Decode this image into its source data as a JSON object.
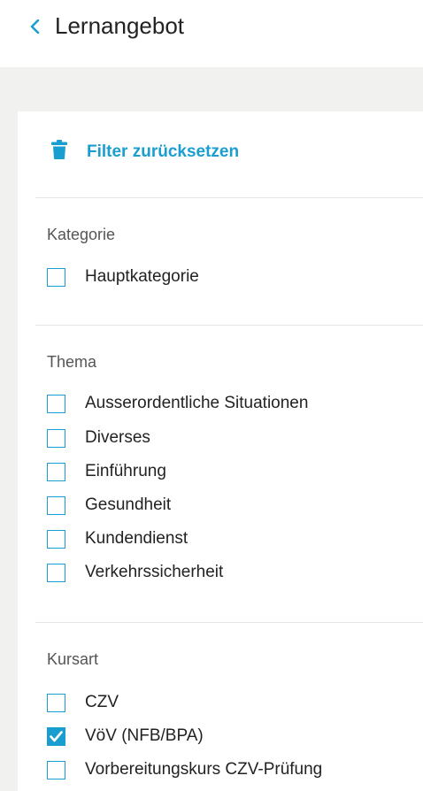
{
  "header": {
    "title": "Lernangebot",
    "back_icon": "chevron-left-icon",
    "accent_color": "#1a9ecf"
  },
  "filters": {
    "reset_label": "Filter zurücksetzen",
    "reset_icon": "trash-icon",
    "sections": [
      {
        "title": "Kategorie",
        "options": [
          {
            "label": "Hauptkategorie",
            "checked": false
          }
        ]
      },
      {
        "title": "Thema",
        "options": [
          {
            "label": "Ausserordentliche Situationen",
            "checked": false
          },
          {
            "label": "Diverses",
            "checked": false
          },
          {
            "label": "Einführung",
            "checked": false
          },
          {
            "label": "Gesundheit",
            "checked": false
          },
          {
            "label": "Kundendienst",
            "checked": false
          },
          {
            "label": "Verkehrssicherheit",
            "checked": false
          }
        ]
      },
      {
        "title": "Kursart",
        "options": [
          {
            "label": "CZV",
            "checked": false
          },
          {
            "label": "VöV (NFB/BPA)",
            "checked": true
          },
          {
            "label": "Vorbereitungskurs CZV-Prüfung",
            "checked": false
          }
        ]
      }
    ]
  }
}
